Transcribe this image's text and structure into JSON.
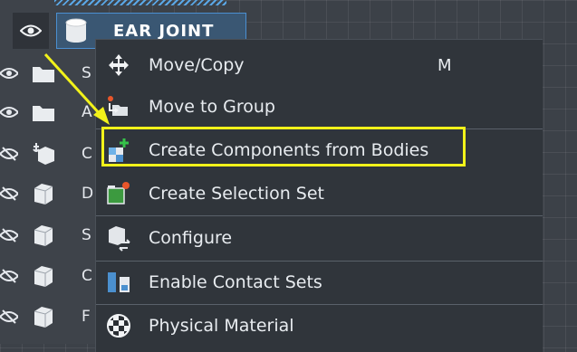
{
  "header": {
    "title": "EAR JOINT",
    "eye_icon": "eye-icon",
    "body_icon": "cylinder-icon"
  },
  "tree_rows": [
    {
      "label": "S",
      "visibility_icon": "eye-icon",
      "type_icon": "folder-icon"
    },
    {
      "label": "A",
      "visibility_icon": "eye-icon",
      "type_icon": "folder-icon"
    },
    {
      "label": "C",
      "visibility_icon": "eye-hidden-icon",
      "type_icon": "joint-component-icon"
    },
    {
      "label": "D",
      "visibility_icon": "eye-hidden-icon",
      "type_icon": "body-cube-icon"
    },
    {
      "label": "S",
      "visibility_icon": "eye-hidden-icon",
      "type_icon": "body-cube-icon"
    },
    {
      "label": "C",
      "visibility_icon": "eye-hidden-icon",
      "type_icon": "body-cube-icon"
    },
    {
      "label": "F",
      "visibility_icon": "eye-hidden-icon",
      "type_icon": "body-cube-icon"
    }
  ],
  "menu": {
    "items": [
      {
        "label": "Move/Copy",
        "shortcut": "M",
        "icon": "move-arrows-icon"
      },
      {
        "label": "Move to Group",
        "shortcut": "",
        "icon": "move-to-group-icon"
      },
      {
        "label": "Create Components from Bodies",
        "shortcut": "",
        "icon": "create-components-icon"
      },
      {
        "label": "Create Selection Set",
        "shortcut": "",
        "icon": "selection-set-icon"
      },
      {
        "label": "Configure",
        "shortcut": "",
        "icon": "configure-icon"
      },
      {
        "label": "Enable Contact Sets",
        "shortcut": "",
        "icon": "contact-sets-icon"
      },
      {
        "label": "Physical Material",
        "shortcut": "",
        "icon": "physical-material-icon"
      }
    ]
  },
  "annotation": {
    "highlight_color": "#f2f21a",
    "arrow_color": "#f2f21a"
  },
  "colors": {
    "selection_fill": "#3a5773",
    "selection_border": "#4b8fd1",
    "menu_bg": "#30353b"
  }
}
